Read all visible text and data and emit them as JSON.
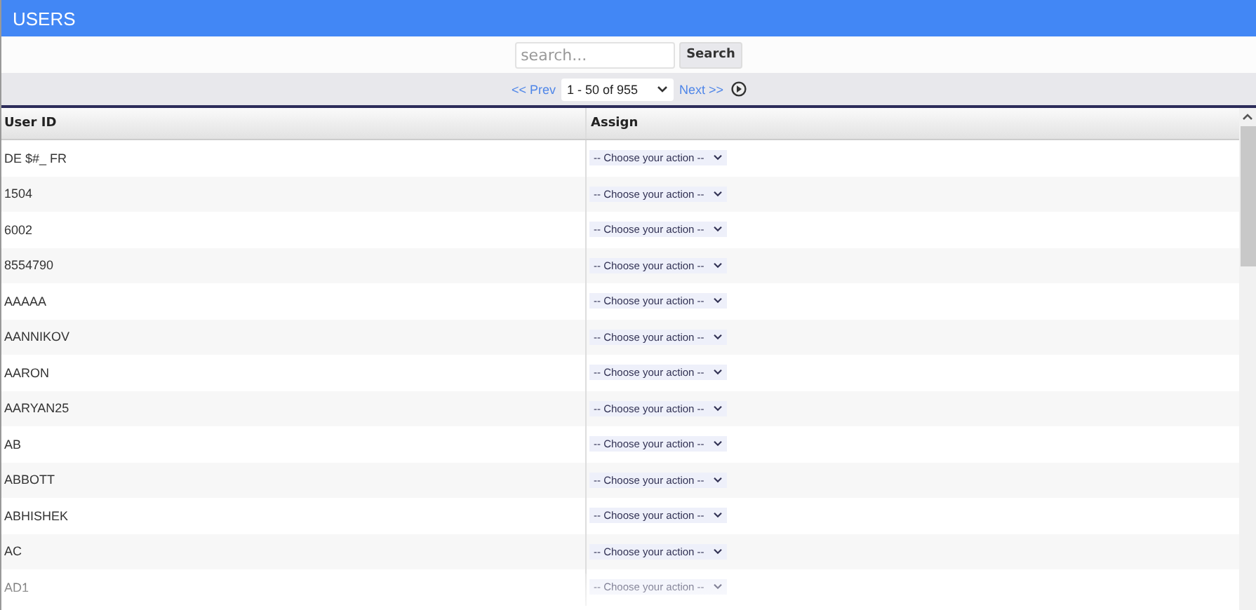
{
  "window": {
    "title": "USERS"
  },
  "search": {
    "placeholder": "search...",
    "button": "Search"
  },
  "pager": {
    "prev": "<< Prev",
    "range": "1 - 50 of 955",
    "next": "Next >>"
  },
  "table": {
    "columns": [
      "User ID",
      "Assign"
    ],
    "rows": [
      {
        "user_id": "DE $#_ FR",
        "assign": "-- Choose your action --"
      },
      {
        "user_id": "1504",
        "assign": "-- Choose your action --"
      },
      {
        "user_id": "6002",
        "assign": "-- Choose your action --"
      },
      {
        "user_id": "8554790",
        "assign": "-- Choose your action --"
      },
      {
        "user_id": "AAAAA",
        "assign": "-- Choose your action --"
      },
      {
        "user_id": "AANNIKOV",
        "assign": "-- Choose your action --"
      },
      {
        "user_id": "AARON",
        "assign": "-- Choose your action --"
      },
      {
        "user_id": "AARYAN25",
        "assign": "-- Choose your action --"
      },
      {
        "user_id": "AB",
        "assign": "-- Choose your action --"
      },
      {
        "user_id": "ABBOTT",
        "assign": "-- Choose your action --"
      },
      {
        "user_id": "ABHISHEK",
        "assign": "-- Choose your action --"
      },
      {
        "user_id": "AC",
        "assign": "-- Choose your action --"
      },
      {
        "user_id": "AD1",
        "assign": "-- Choose your action --"
      }
    ]
  }
}
